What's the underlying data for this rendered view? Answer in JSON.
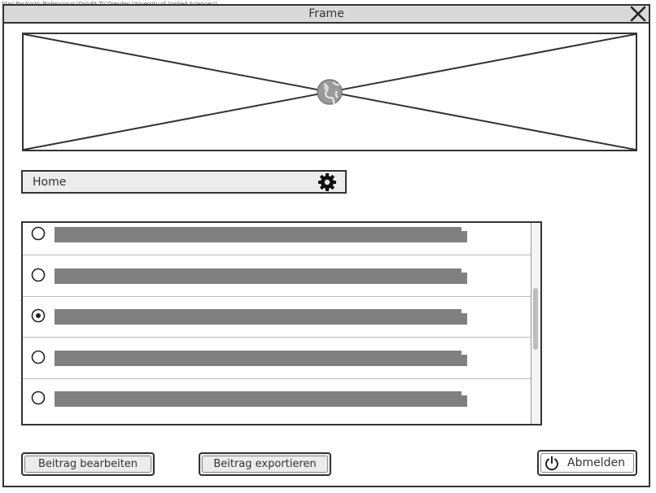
{
  "watermark": "Stan Pasikogin Professional (OnlyFit TV Dresden University of Applied Sciences))",
  "window": {
    "title": "Frame"
  },
  "home_bar": {
    "label": "Home"
  },
  "list": {
    "items": [
      {
        "selected": false
      },
      {
        "selected": false
      },
      {
        "selected": true
      },
      {
        "selected": false
      },
      {
        "selected": false
      }
    ]
  },
  "buttons": {
    "edit_label": "Beitrag bearbeiten",
    "export_label": "Beitrag exportieren",
    "logout_label": "Abmelden"
  },
  "icons": {
    "close": "close-icon",
    "image": "globe-icon",
    "settings": "gear-icon",
    "logout": "power-icon"
  },
  "colors": {
    "outline": "#333333",
    "text_bar": "#808080",
    "title_bar": "#d9d9d9"
  }
}
